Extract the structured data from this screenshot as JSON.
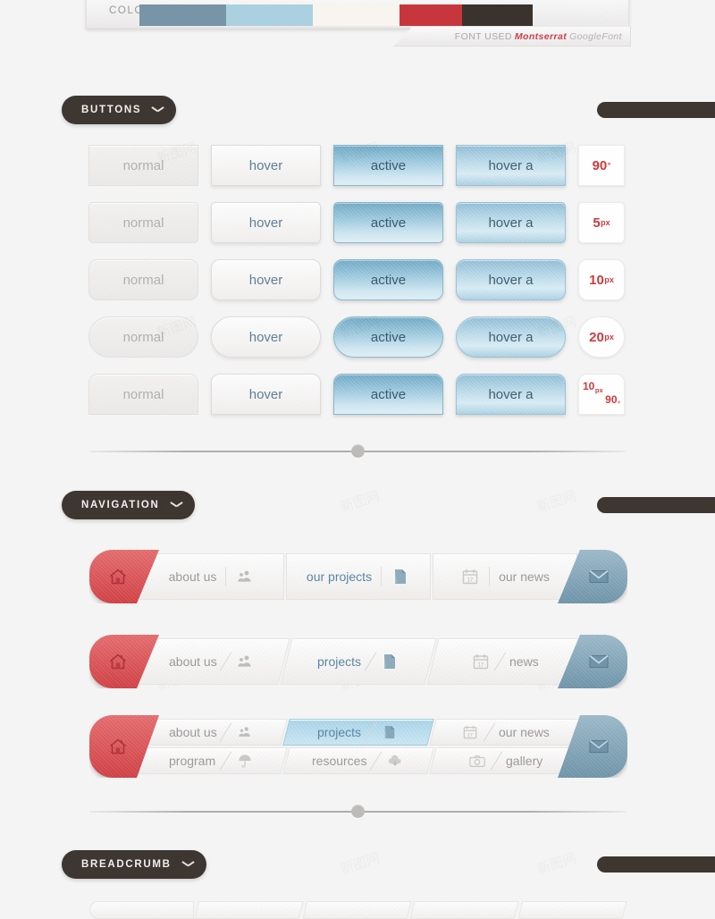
{
  "palette": {
    "steel_blue": "#7795a6",
    "light_blue": "#abd0e0",
    "cream": "#f8f4ef",
    "red": "#c8363d",
    "dark_brown": "#3a322d"
  },
  "colors_panel": {
    "label": "COLORS USED",
    "swatches": [
      "#7795a6",
      "#abd0e0",
      "#f8f4ef",
      "#c8363d",
      "#3a322d"
    ],
    "font_used_prefix": "FONT USED",
    "font_name": "Montserrat",
    "font_source": "GoogleFont"
  },
  "sections": {
    "buttons": {
      "title": "BUTTONS",
      "chevron": "chevron-down-icon"
    },
    "navigation": {
      "title": "NAVIGATION",
      "chevron": "chevron-down-icon"
    },
    "breadcrumb": {
      "title": "BREADCRUMB",
      "chevron": "chevron-down-icon"
    }
  },
  "buttons": {
    "states": [
      "normal",
      "hover",
      "active",
      "hover a"
    ],
    "rows": [
      {
        "radius_label_num": "90",
        "radius_label_unit": "°",
        "radius_css": "r-0",
        "cells": [
          "normal",
          "hover",
          "active",
          "hover a"
        ]
      },
      {
        "radius_label_num": "5",
        "radius_label_unit": "px",
        "radius_css": "r-5",
        "cells": [
          "normal",
          "hover",
          "active",
          "hover a"
        ]
      },
      {
        "radius_label_num": "10",
        "radius_label_unit": "px",
        "radius_css": "r-10",
        "cells": [
          "normal",
          "hover",
          "active",
          "hover a"
        ]
      },
      {
        "radius_label_num": "20",
        "radius_label_unit": "px",
        "radius_css": "r-20",
        "cells": [
          "normal",
          "hover",
          "active",
          "hover a"
        ]
      },
      {
        "radius_label_num": "10",
        "radius_label_unit": "px",
        "radius_label_num2": "90",
        "radius_label_unit2": "°",
        "radius_css": "r-mix",
        "cells": [
          "normal",
          "hover",
          "active",
          "hover a"
        ]
      }
    ]
  },
  "navigation": {
    "bars": [
      {
        "style": "straight",
        "home_icon": "home-icon",
        "mail_icon": "envelope-icon",
        "segments": [
          {
            "items": [
              {
                "type": "label",
                "text": "about us",
                "active": false
              },
              {
                "type": "icon",
                "icon": "users-icon"
              }
            ]
          },
          {
            "items": [
              {
                "type": "label",
                "text": "our projects",
                "active": true
              },
              {
                "type": "icon",
                "icon": "document-icon"
              }
            ]
          },
          {
            "items": [
              {
                "type": "icon",
                "icon": "calendar-icon"
              },
              {
                "type": "label",
                "text": "our news",
                "active": false
              }
            ]
          }
        ]
      },
      {
        "style": "skewed",
        "home_icon": "home-icon",
        "mail_icon": "envelope-icon",
        "segments": [
          {
            "items": [
              {
                "type": "label",
                "text": "about us",
                "active": false
              },
              {
                "type": "icon",
                "icon": "users-icon"
              }
            ]
          },
          {
            "items": [
              {
                "type": "label",
                "text": "projects",
                "active": true
              },
              {
                "type": "icon",
                "icon": "document-icon"
              }
            ]
          },
          {
            "items": [
              {
                "type": "icon",
                "icon": "calendar-icon"
              },
              {
                "type": "label",
                "text": "news",
                "active": false
              }
            ]
          }
        ]
      },
      {
        "style": "two-row",
        "home_icon": "home-icon",
        "mail_icon": "envelope-icon",
        "row_top": [
          {
            "label": "about us",
            "icon": "users-icon",
            "active": false
          },
          {
            "label": "projects",
            "icon": "document-icon",
            "active": true
          },
          {
            "label": "our news",
            "icon": "calendar-icon",
            "active": false
          }
        ],
        "row_bottom": [
          {
            "label": "program",
            "icon": "umbrella-icon",
            "active": false
          },
          {
            "label": "resources",
            "icon": "cloud-download-icon",
            "active": false
          },
          {
            "label": "gallery",
            "icon": "camera-icon",
            "active": false
          }
        ]
      }
    ]
  },
  "calendar_day": "17"
}
